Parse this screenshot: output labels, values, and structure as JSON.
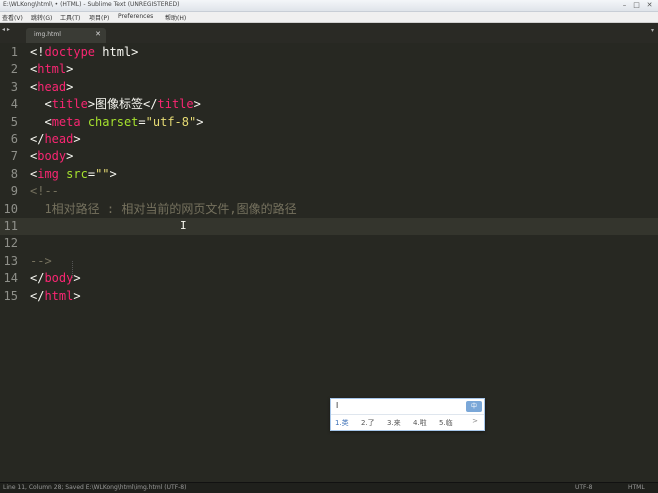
{
  "window": {
    "title": "E:\\WLKong\\html\\ • (HTML) - Sublime Text (UNREGISTERED)",
    "minimize": "–",
    "maximize": "□",
    "close": "✕"
  },
  "menu": [
    "查看(V)",
    "跳转(G)",
    "工具(T)",
    "项目(P)",
    "Preferences",
    "帮助(H)"
  ],
  "tabs": {
    "arrows": "◂ ▸",
    "active_label": "img.html",
    "close_glyph": "✕",
    "dropdown_glyph": "▾"
  },
  "editor": {
    "line_numbers": [
      "1",
      "2",
      "3",
      "4",
      "5",
      "6",
      "7",
      "8",
      "9",
      "10",
      "11",
      "12",
      "13",
      "14",
      "15"
    ],
    "current_line": "11",
    "lines": [
      [
        {
          "t": "<!",
          "c": "p"
        },
        {
          "t": "doctype",
          "c": "tag"
        },
        {
          "t": " html>",
          "c": "p"
        }
      ],
      [
        {
          "t": "<",
          "c": "p"
        },
        {
          "t": "html",
          "c": "tag"
        },
        {
          "t": ">",
          "c": "p"
        }
      ],
      [
        {
          "t": "<",
          "c": "p"
        },
        {
          "t": "head",
          "c": "tag"
        },
        {
          "t": ">",
          "c": "p"
        }
      ],
      [
        {
          "t": "  <",
          "c": "p"
        },
        {
          "t": "title",
          "c": "tag"
        },
        {
          "t": ">图像标签</",
          "c": "p"
        },
        {
          "t": "title",
          "c": "tag"
        },
        {
          "t": ">",
          "c": "p"
        }
      ],
      [
        {
          "t": "  <",
          "c": "p"
        },
        {
          "t": "meta",
          "c": "tag"
        },
        {
          "t": " ",
          "c": "p"
        },
        {
          "t": "charset",
          "c": "attr"
        },
        {
          "t": "=",
          "c": "p"
        },
        {
          "t": "\"utf-8\"",
          "c": "str"
        },
        {
          "t": ">",
          "c": "p"
        }
      ],
      [
        {
          "t": "</",
          "c": "p"
        },
        {
          "t": "head",
          "c": "tag"
        },
        {
          "t": ">",
          "c": "p"
        }
      ],
      [
        {
          "t": "<",
          "c": "p"
        },
        {
          "t": "body",
          "c": "tag"
        },
        {
          "t": ">",
          "c": "p"
        }
      ],
      [
        {
          "t": "<",
          "c": "p"
        },
        {
          "t": "img",
          "c": "tag"
        },
        {
          "t": " ",
          "c": "p"
        },
        {
          "t": "src",
          "c": "attr"
        },
        {
          "t": "=",
          "c": "p"
        },
        {
          "t": "\"\"",
          "c": "str"
        },
        {
          "t": ">",
          "c": "p"
        }
      ],
      [
        {
          "t": "<!--",
          "c": "cmt"
        }
      ],
      [
        {
          "t": "  1相对路径 : 相对当前的网页文件,图像的路径",
          "c": "cmt"
        }
      ],
      [
        {
          "t": "",
          "c": "p"
        }
      ],
      [
        {
          "t": "",
          "c": "p"
        }
      ],
      [
        {
          "t": "-->",
          "c": "cmt"
        }
      ],
      [
        {
          "t": "</",
          "c": "p"
        },
        {
          "t": "body",
          "c": "tag"
        },
        {
          "t": ">",
          "c": "p"
        }
      ],
      [
        {
          "t": "</",
          "c": "p"
        },
        {
          "t": "html",
          "c": "tag"
        },
        {
          "t": ">",
          "c": "p"
        }
      ]
    ],
    "cursor_glyph": "I"
  },
  "ime": {
    "input": "l",
    "logo": "中",
    "candidates": [
      "1.类",
      "2.了",
      "3.来",
      "4.啦",
      "5.临"
    ],
    "next_arrow": ">"
  },
  "status": {
    "left": "Line 11, Column 28; Saved E:\\WLKong\\html\\img.html (UTF-8)",
    "encoding": "UTF-8",
    "syntax": "HTML"
  },
  "colors": {
    "background": "#272822",
    "tag": "#f92672",
    "attribute": "#a6e22e",
    "string": "#e6db74",
    "comment": "#75715e",
    "text": "#f8f8f2",
    "line_number": "#8f908a"
  }
}
